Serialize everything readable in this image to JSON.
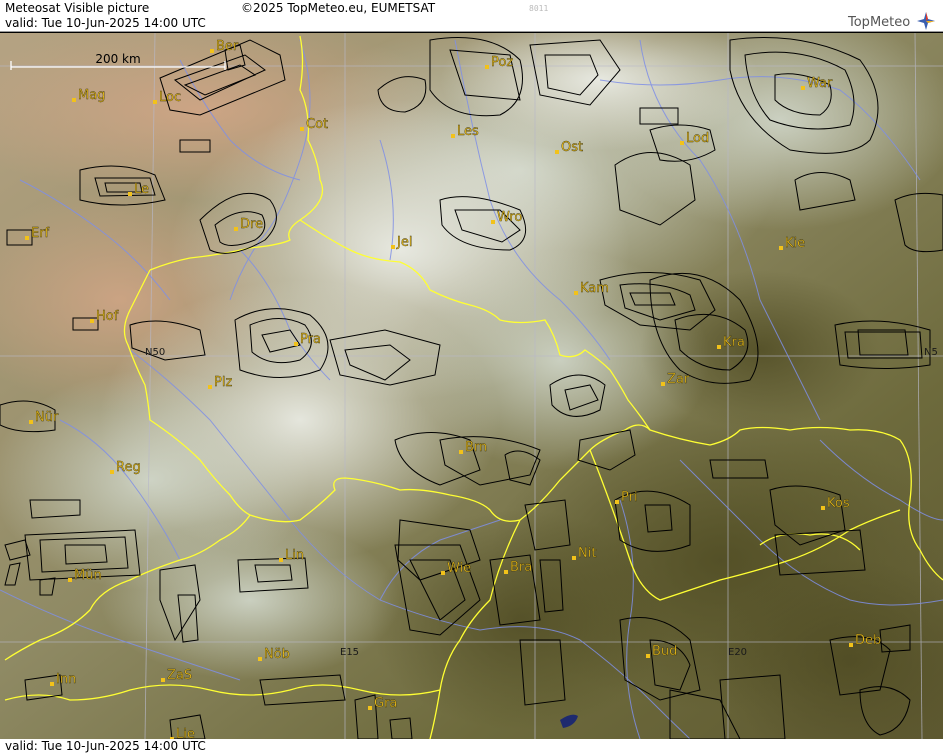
{
  "header": {
    "product_title": "Meteosat Visible picture",
    "copyright": "©2025 TopMeteo.eu, EUMETSAT",
    "valid_line": "valid:  Tue  10-Jun-2025  14:00 UTC",
    "image_number": "8011",
    "brand": "TopMeteo"
  },
  "footer": {
    "valid_line": "valid:  Tue  10-Jun-2025  14:00 UTC"
  },
  "scale_bar": {
    "label": "200 km"
  },
  "grid_labels": {
    "lat_n50_west": "N50",
    "lat_n50_east": "N5",
    "lon_e15": "E15",
    "lon_e20": "E20"
  },
  "cities": [
    {
      "id": "ber",
      "label": "Ber"
    },
    {
      "id": "mag",
      "label": "Mag"
    },
    {
      "id": "loc",
      "label": "Loc"
    },
    {
      "id": "cot",
      "label": "Cot"
    },
    {
      "id": "poz",
      "label": "Poz"
    },
    {
      "id": "war",
      "label": "War"
    },
    {
      "id": "les",
      "label": "Les"
    },
    {
      "id": "ost",
      "label": "Ost"
    },
    {
      "id": "lod",
      "label": "Lod"
    },
    {
      "id": "lei",
      "label": "Le"
    },
    {
      "id": "dre",
      "label": "Dre"
    },
    {
      "id": "wro",
      "label": "Wro"
    },
    {
      "id": "erf",
      "label": "Erf"
    },
    {
      "id": "jel",
      "label": "Jel"
    },
    {
      "id": "kie",
      "label": "Kie"
    },
    {
      "id": "kam",
      "label": "Kam"
    },
    {
      "id": "hof",
      "label": "Hof"
    },
    {
      "id": "pra",
      "label": "Pra"
    },
    {
      "id": "kra",
      "label": "Kra"
    },
    {
      "id": "plz",
      "label": "Plz"
    },
    {
      "id": "zar",
      "label": "Zar"
    },
    {
      "id": "nur",
      "label": "Nür"
    },
    {
      "id": "brn",
      "label": "Brn"
    },
    {
      "id": "reg",
      "label": "Reg"
    },
    {
      "id": "pri",
      "label": "Pri"
    },
    {
      "id": "kos",
      "label": "Kos"
    },
    {
      "id": "lin",
      "label": "Lin"
    },
    {
      "id": "nit",
      "label": "Nit"
    },
    {
      "id": "wie",
      "label": "Wie"
    },
    {
      "id": "bra",
      "label": "Bra"
    },
    {
      "id": "mun",
      "label": "Mün"
    },
    {
      "id": "bud",
      "label": "Bud"
    },
    {
      "id": "deb",
      "label": "Deb"
    },
    {
      "id": "nob",
      "label": "Nöb"
    },
    {
      "id": "inn",
      "label": "Inn"
    },
    {
      "id": "zas",
      "label": "ZaS"
    },
    {
      "id": "gra",
      "label": "Gra"
    },
    {
      "id": "lie",
      "label": "Lie"
    }
  ],
  "colors": {
    "city_label": "#f2c21a",
    "country_border": "#ffff33",
    "river": "#7f8fe6",
    "grid": "#b8b8c8",
    "airspace": "#000000"
  }
}
